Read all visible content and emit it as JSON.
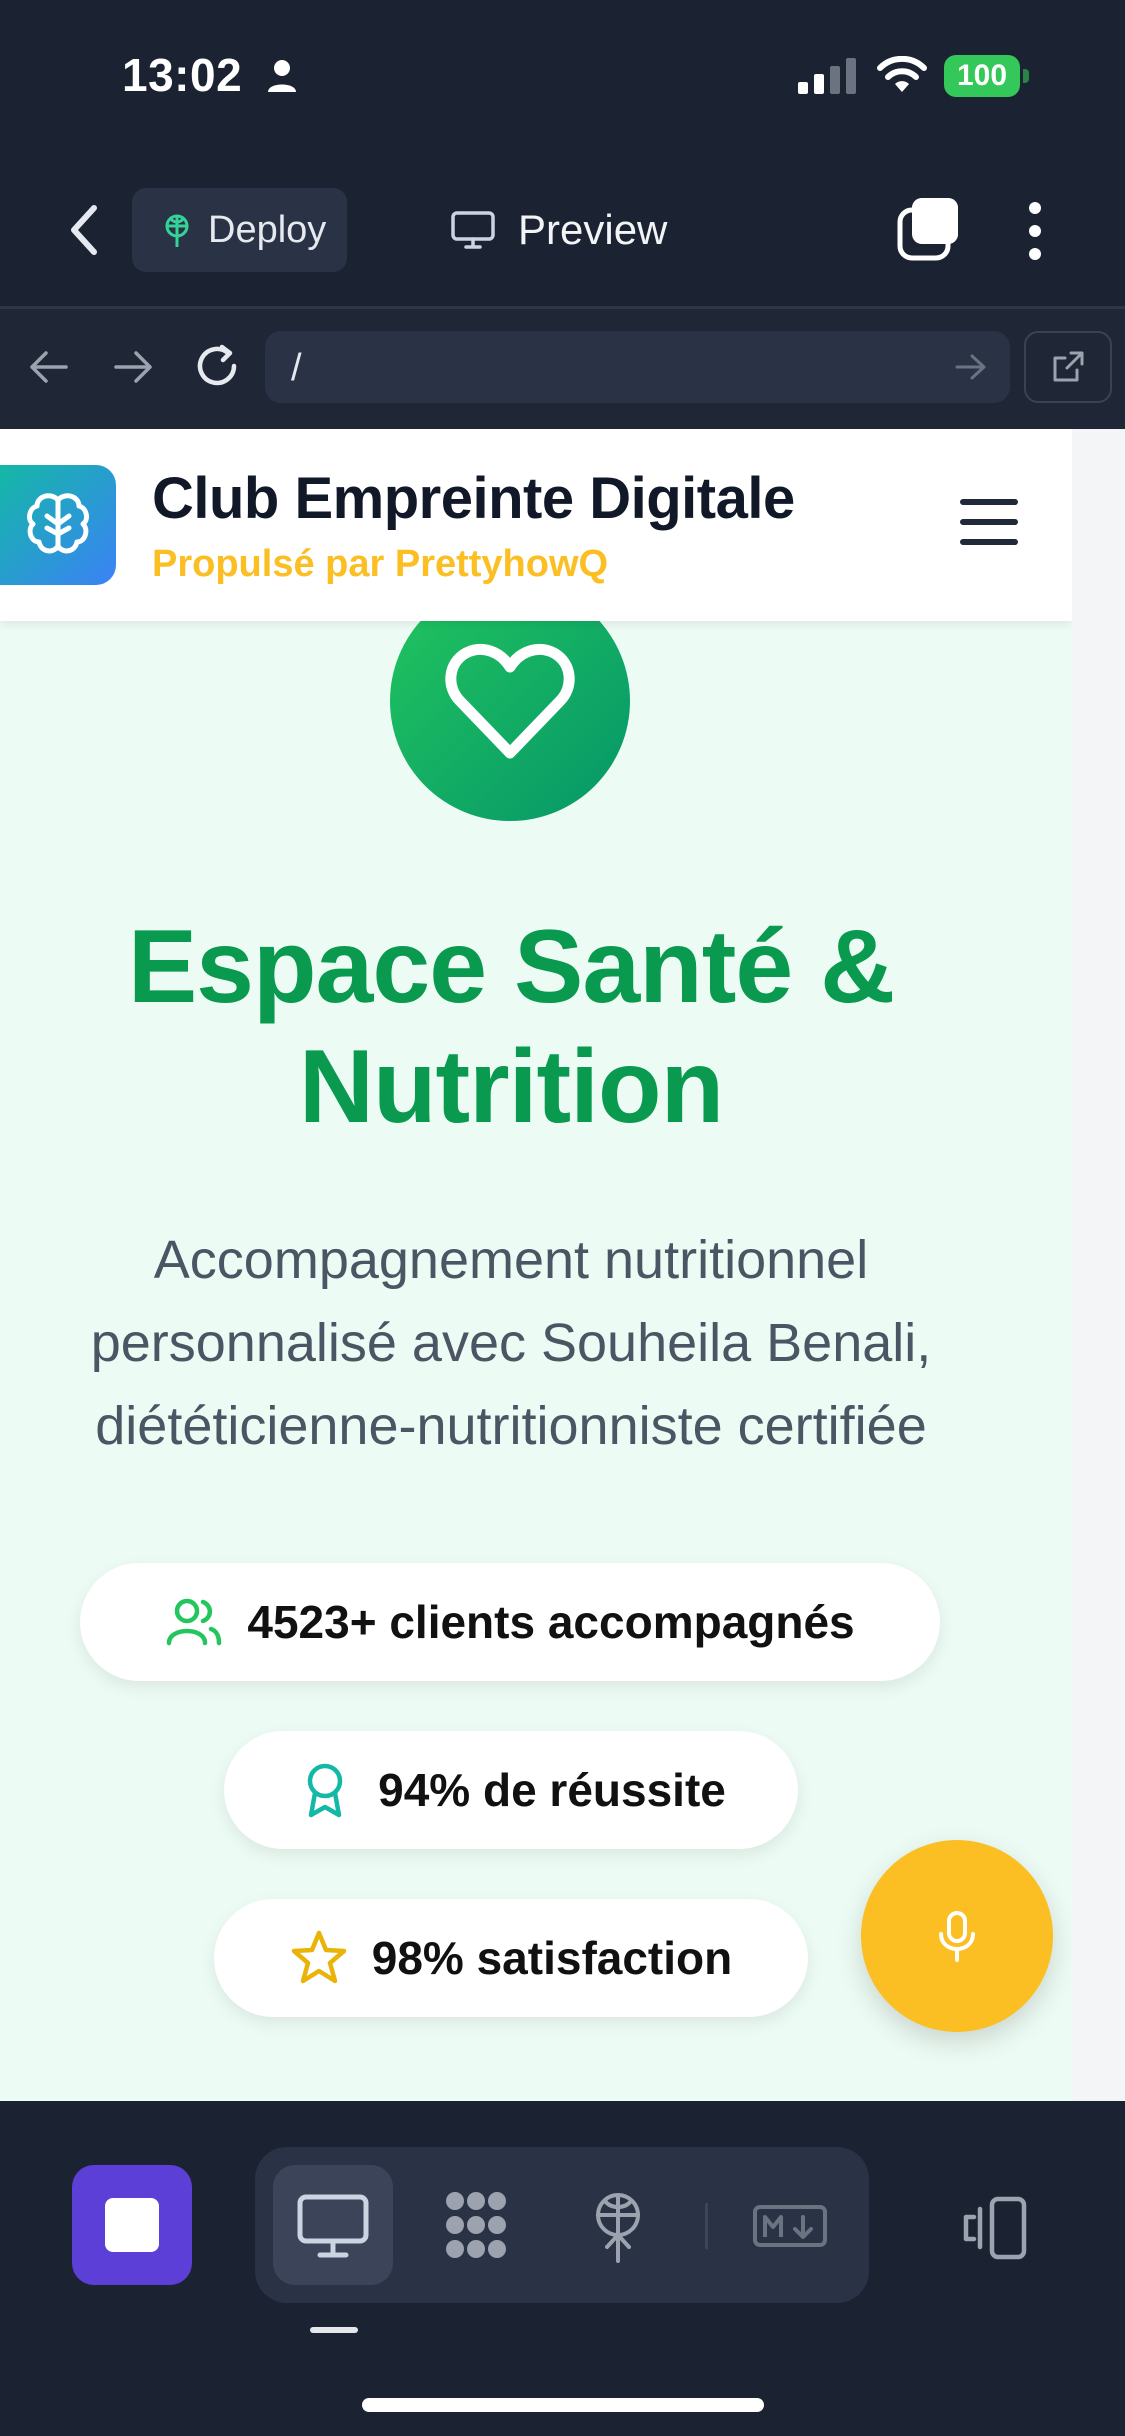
{
  "status_bar": {
    "time": "13:02",
    "battery": "100",
    "icons": [
      "person-icon",
      "signal-icon",
      "wifi-icon",
      "battery-icon"
    ]
  },
  "app_bar": {
    "deploy_label": "Deploy",
    "preview_label": "Preview",
    "icons": [
      "back-icon",
      "deploy-icon",
      "monitor-icon",
      "tabs-icon",
      "more-icon"
    ]
  },
  "url_bar": {
    "url": "/",
    "icons": [
      "nav-back-icon",
      "nav-forward-icon",
      "reload-icon",
      "go-icon",
      "open-external-icon"
    ]
  },
  "site": {
    "title": "Club Empreinte Digitale",
    "subtitle": "Propulsé par PrettyhowQ",
    "hero_title": "Espace Santé & Nutrition",
    "hero_description": "Accompagnement nutritionnel personnalisé avec Souheila Benali, diététicienne-nutritionniste certifiée",
    "stats": [
      {
        "icon": "users-icon",
        "label": "4523+ clients accompagnés"
      },
      {
        "icon": "award-icon",
        "label": "94% de réussite"
      },
      {
        "icon": "star-icon",
        "label": "98% satisfaction"
      }
    ],
    "colors": {
      "brand_green": "#0a9a4f",
      "accent_yellow": "#fbbf24",
      "page_background": "#ecfbf3"
    }
  },
  "bottom_toolbar": {
    "icons": [
      "stop-icon",
      "desktop-icon",
      "components-icon",
      "deploy-icon",
      "markdown-icon",
      "devices-icon"
    ],
    "selected": "desktop"
  },
  "theme": {
    "app_background": "#1b2232",
    "stop_button": "#5b3fd6"
  }
}
